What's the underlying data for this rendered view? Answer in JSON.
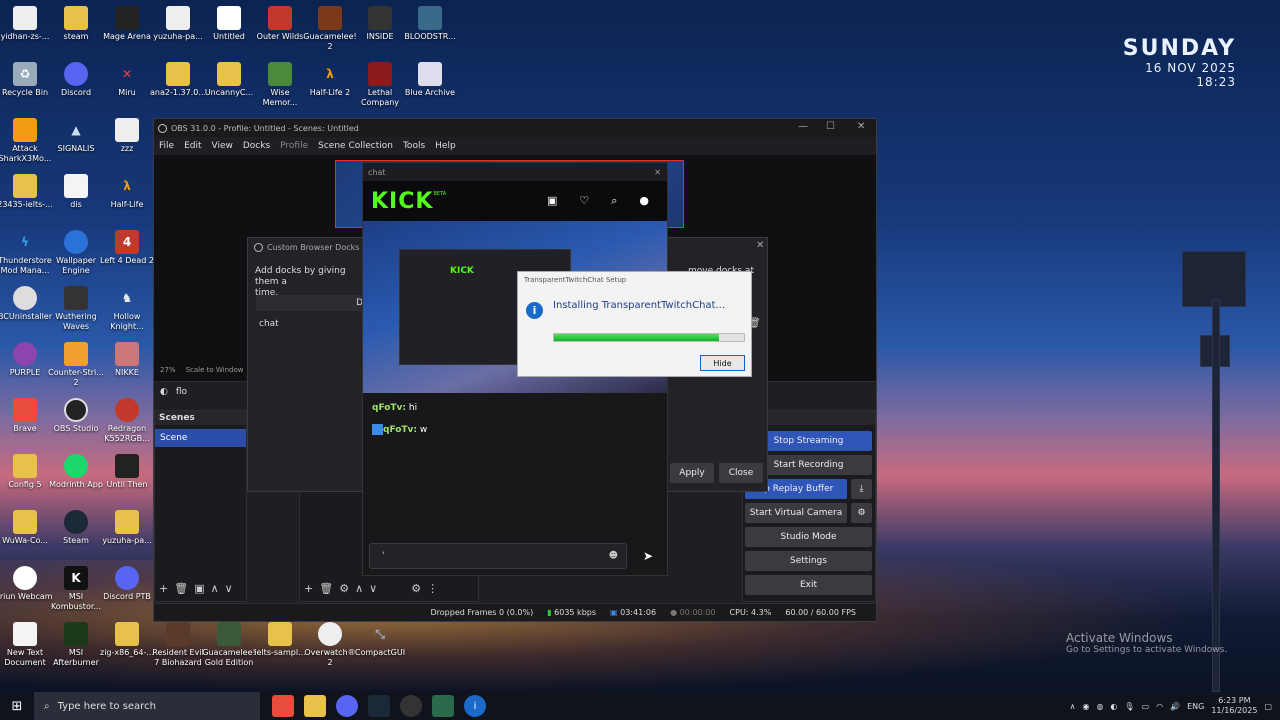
{
  "desktop": {
    "clock": {
      "day": "SUNDAY",
      "date": "16 NOV 2025",
      "time": "18:23"
    },
    "icons_row1": [
      "yidhan-zs-...",
      "steam",
      "Mage Arena",
      "yuzuha-pa...",
      "Untitled",
      "Outer Wilds",
      "Guacamelee! 2",
      "INSIDE",
      "BLOODSTR..."
    ],
    "icons_row2": [
      "Recycle Bin",
      "Discord",
      "Miru",
      "ana2-1.37.0...",
      "UncannyC...",
      "Wise Memor...",
      "Half-Life 2",
      "Lethal Company",
      "Blue Archive"
    ],
    "col1": [
      "Attack SharkX3Mo...",
      "23435-ielts-...",
      "Thunderstore Mod Mana...",
      "BCUninstaller",
      "PURPLE",
      "Brave",
      "Config 5",
      "WuWa-Co...",
      "Iriun Webcam",
      "New Text Document"
    ],
    "col2": [
      "SIGNALIS",
      "dis",
      "Wallpaper Engine",
      "Wuthering Waves",
      "Counter-Stri... 2",
      "OBS Studio",
      "Modrinth App",
      "Steam",
      "MSI Kombustor...",
      "MSI Afterburner"
    ],
    "col3": [
      "zzz",
      "Half-Life",
      "Left 4 Dead 2",
      "Hollow Knight...",
      "NIKKE",
      "Redragon K552RGB...",
      "Until Then",
      "yuzuha-pa...",
      "Discord PTB",
      "zig-x86_64-..."
    ],
    "bottom_row": [
      "Resident Evil 7 Biohazard",
      "Guacamelee! Gold Edition",
      "ielts-sampl...",
      "Overwatch® 2",
      "CompactGUI"
    ],
    "watermark": {
      "title": "Activate Windows",
      "subtitle": "Go to Settings to activate Windows."
    }
  },
  "obs": {
    "title": "OBS 31.0.0 - Profile: Untitled - Scenes: Untitled",
    "menu": [
      "File",
      "Edit",
      "View",
      "Docks",
      "Profile",
      "Scene Collection",
      "Tools",
      "Help"
    ],
    "zoom": "27%",
    "scale_label": "Scale to Window",
    "source_name": "flo",
    "scenes_header": "Scenes",
    "scene": "Scene",
    "controls_header": "ols",
    "controls": {
      "stop_streaming": "Stop Streaming",
      "start_recording": "Start Recording",
      "replay_buffer": "op Replay Buffer",
      "virtual_camera": "Start Virtual Camera",
      "studio_mode": "Studio Mode",
      "settings": "Settings",
      "exit": "Exit"
    },
    "status": {
      "dropped": "Dropped Frames 0 (0.0%)",
      "bitrate": "6035 kbps",
      "stream_time": "03:41:06",
      "rec_time": "00:00:00",
      "cpu": "CPU: 4.3%",
      "fps": "60.00 / 60.00 FPS"
    }
  },
  "browser_docks": {
    "title": "Custom Browser Docks",
    "text": "Add docks by giving them a",
    "text2": "time.",
    "text_right": "move docks at any",
    "col_header": "D",
    "row": "chat",
    "apply": "Apply",
    "close": "Close"
  },
  "chat": {
    "title": "chat",
    "logo": "KICK",
    "logo_badge": "BETA",
    "messages": [
      {
        "user": "qFoTv:",
        "text": "hi"
      },
      {
        "user": "qFoTv:",
        "text": "w"
      }
    ],
    "input_value": "'"
  },
  "setup": {
    "title": "TransparentTwitchChat Setup",
    "message": "Installing TransparentTwitchChat...",
    "progress": 0.87,
    "hide": "Hide"
  },
  "taskbar": {
    "search_placeholder": "Type here to search",
    "lang": "ENG",
    "time": "6:23 PM",
    "date": "11/16/2025"
  }
}
